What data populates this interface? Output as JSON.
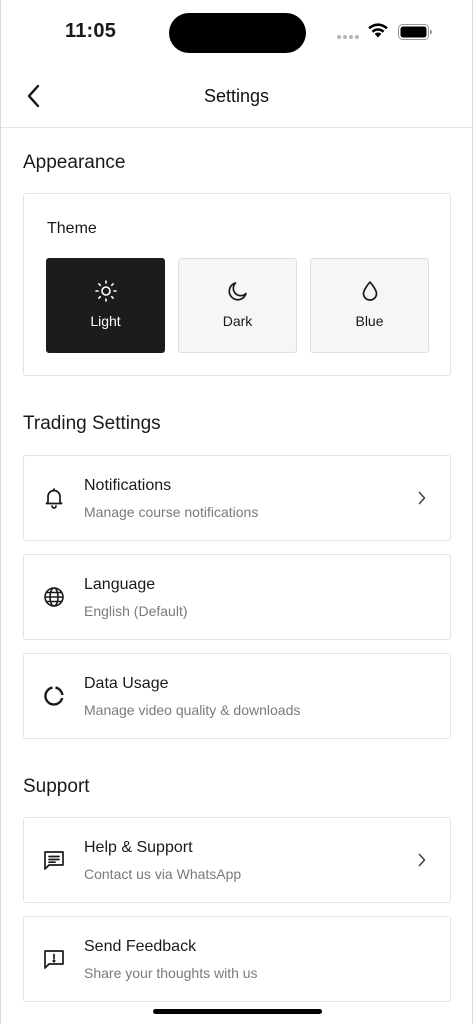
{
  "status_bar": {
    "time": "11:05"
  },
  "nav": {
    "title": "Settings"
  },
  "appearance": {
    "section_title": "Appearance",
    "theme_label": "Theme",
    "options": [
      {
        "label": "Light",
        "icon": "sun-icon",
        "selected": true
      },
      {
        "label": "Dark",
        "icon": "moon-icon",
        "selected": false
      },
      {
        "label": "Blue",
        "icon": "droplet-icon",
        "selected": false
      }
    ]
  },
  "trading": {
    "section_title": "Trading Settings",
    "items": [
      {
        "title": "Notifications",
        "subtitle": "Manage course notifications",
        "icon": "bell-icon",
        "chevron": true
      },
      {
        "title": "Language",
        "subtitle": "English (Default)",
        "icon": "globe-icon",
        "chevron": false
      },
      {
        "title": "Data Usage",
        "subtitle": "Manage video quality & downloads",
        "icon": "data-usage-icon",
        "chevron": false
      }
    ]
  },
  "support": {
    "section_title": "Support",
    "items": [
      {
        "title": "Help & Support",
        "subtitle": "Contact us via WhatsApp",
        "icon": "message-icon",
        "chevron": true
      },
      {
        "title": "Send Feedback",
        "subtitle": "Share your thoughts with us",
        "icon": "feedback-icon",
        "chevron": false
      }
    ]
  },
  "colors": {
    "selected_theme_bg": "#1c1c1c",
    "card_border": "#e3e3e3",
    "subtitle": "#7a7a7a"
  }
}
